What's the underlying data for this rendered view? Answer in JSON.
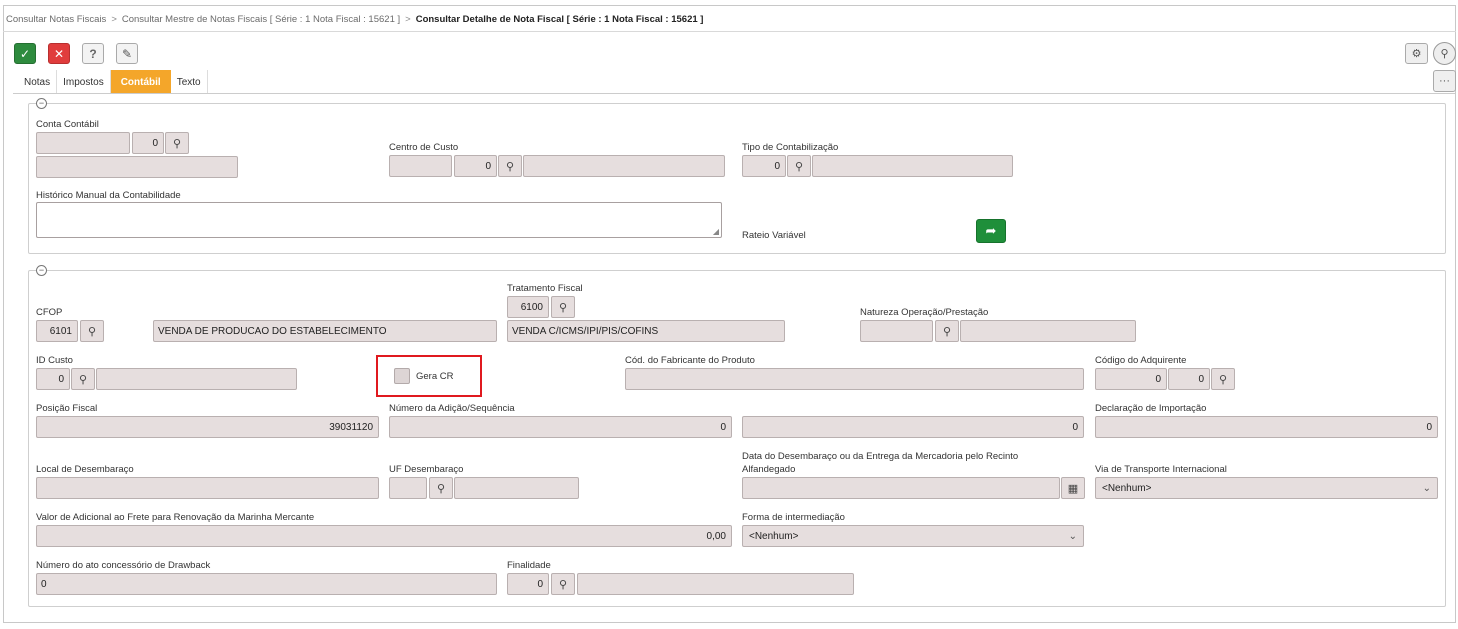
{
  "breadcrumb": {
    "items": [
      "Consultar Notas Fiscais",
      "Consultar Mestre de Notas Fiscais [ Série : 1 Nota Fiscal : 15621 ]"
    ],
    "separator": ">",
    "current": "Consultar Detalhe de Nota Fiscal [ Série : 1 Nota Fiscal : 15621 ]"
  },
  "toolbar": {
    "ok_icon": "✓",
    "cancel_icon": "✕",
    "help_icon": "?",
    "tools_icon": "✎",
    "settings_icon": "⚙",
    "search_icon": "⚲",
    "more_icon": "···"
  },
  "tabs": [
    {
      "label": "Notas",
      "active": false
    },
    {
      "label": "Impostos",
      "active": false
    },
    {
      "label": "Contábil",
      "active": true
    },
    {
      "label": "Texto",
      "active": false
    }
  ],
  "colors": {
    "accent": "#f4a62a",
    "ok": "#2e8b3e",
    "cancel": "#e03c3c",
    "highlight": "#e0191f"
  },
  "panel1": {
    "conta_contabil": {
      "label": "Conta Contábil",
      "code": "0"
    },
    "centro_custo": {
      "label": "Centro de Custo",
      "code": "0"
    },
    "tipo_contabilizacao": {
      "label": "Tipo de Contabilização",
      "code": "0"
    },
    "historico": {
      "label": "Histórico Manual da Contabilidade"
    },
    "rateio": {
      "label": "Rateio Variável",
      "button_icon": "➦"
    }
  },
  "panel2": {
    "tratamento_fiscal": {
      "label": "Tratamento Fiscal",
      "code": "6100",
      "desc": "VENDA C/ICMS/IPI/PIS/COFINS"
    },
    "cfop": {
      "label": "CFOP",
      "code": "6101",
      "desc": "VENDA DE PRODUCAO DO ESTABELECIMENTO"
    },
    "natureza": {
      "label": "Natureza Operação/Prestação"
    },
    "id_custo": {
      "label": "ID Custo",
      "code": "0"
    },
    "gera_cr": {
      "label": "Gera CR",
      "checked": false
    },
    "cod_fabricante": {
      "label": "Cód. do Fabricante do Produto"
    },
    "cod_adquirente": {
      "label": "Código do Adquirente",
      "value1": "0",
      "value2": "0"
    },
    "posicao_fiscal": {
      "label": "Posição Fiscal",
      "value": "39031120"
    },
    "numero_adicao": {
      "label": "Número da Adição/Sequência",
      "value1": "0",
      "value2": "0"
    },
    "declaracao_importacao": {
      "label": "Declaração de Importação",
      "value": "0"
    },
    "local_desembaraco": {
      "label": "Local de Desembaraço"
    },
    "uf_desembaraco": {
      "label": "UF Desembaraço"
    },
    "data_desembaraco": {
      "label_line1": "Data do Desembaraço ou da Entrega da Mercadoria pelo Recinto",
      "label_line2": "Alfandegado",
      "calendar_icon": "▦"
    },
    "via_transporte": {
      "label": "Via de Transporte Internacional",
      "value": "<Nenhum>"
    },
    "valor_adicional": {
      "label": "Valor de Adicional ao Frete para Renovação da Marinha Mercante",
      "value": "0,00"
    },
    "forma_intermediacao": {
      "label": "Forma de intermediação",
      "value": "<Nenhum>"
    },
    "drawback": {
      "label": "Número do ato concessório de Drawback",
      "value": "0"
    },
    "finalidade": {
      "label": "Finalidade",
      "code": "0"
    }
  },
  "icons": {
    "lookup": "⚲",
    "chevron": "⌄",
    "collapse": "−"
  }
}
